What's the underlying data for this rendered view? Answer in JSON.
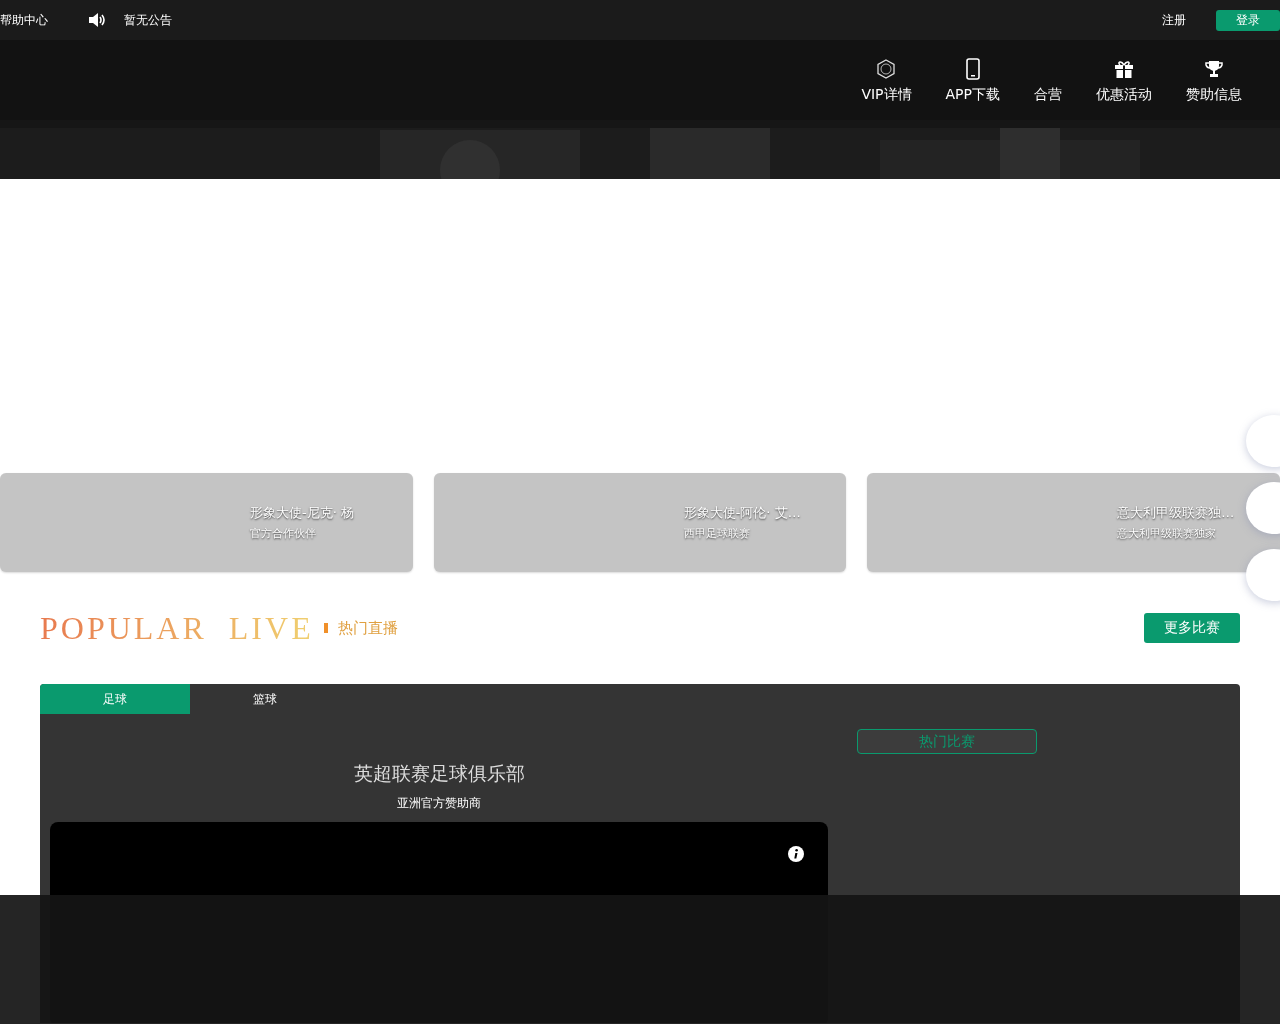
{
  "top_bar": {
    "help": "帮助中心",
    "notice": "暂无公告",
    "register": "注册",
    "login": "登录"
  },
  "nav": [
    {
      "label": "VIP详情"
    },
    {
      "label": "APP下载"
    },
    {
      "label": "合营"
    },
    {
      "label": "优惠活动"
    },
    {
      "label": "赞助信息"
    }
  ],
  "cards": [
    {
      "title": "形象大使-尼克· 杨",
      "subtitle": "官方合作伙伴"
    },
    {
      "title": "形象大使-阿伦· 艾…",
      "subtitle": "西甲足球联赛"
    },
    {
      "title": "意大利甲级联赛独…",
      "subtitle": "意大利甲级联赛独家"
    }
  ],
  "popular": {
    "title_en": "POPULAR  LIVE",
    "title_cn": "热门直播",
    "more": "更多比赛"
  },
  "tabs": [
    {
      "label": "足球",
      "selected": true
    },
    {
      "label": "篮球",
      "selected": false
    }
  ],
  "live": {
    "title": "英超联赛足球俱乐部",
    "subtitle": "亚洲官方赞助商",
    "hot": "热门比赛"
  }
}
